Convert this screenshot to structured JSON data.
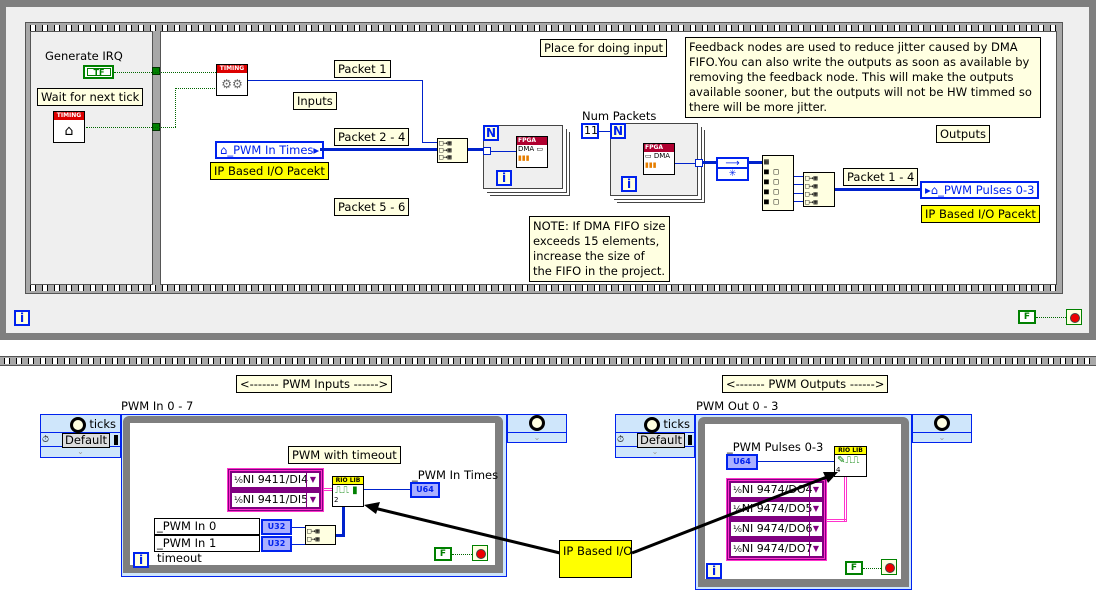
{
  "top_loop": {
    "left_frame": {
      "generate_irq_label": "Generate IRQ",
      "generate_irq_value": "TF",
      "wait_label": "Wait for next tick",
      "timing_icon_label": "TIMING"
    },
    "right_frame": {
      "timing_icon_label": "TIMING",
      "packet1_label": "Packet 1",
      "inputs_label": "Inputs",
      "packet24_label": "Packet 2 - 4",
      "packet56_label": "Packet 5 - 6",
      "pwm_in_times_global": "_PWM In Times",
      "ip_packet_label_in": "IP Based I/O Pacekt",
      "place_input_label": "Place for doing input",
      "for_loop_1": {
        "count_symbol": "N",
        "index_symbol": "i",
        "fpga_label": "FPGA",
        "dma_label": "DMA"
      },
      "num_packets_label": "Num Packets",
      "num_packets_value": "11",
      "for_loop_2": {
        "count_symbol": "N",
        "index_symbol": "i",
        "fpga_label": "FPGA",
        "dma_label": "DMA"
      },
      "feedback_note": "Feedback nodes are used to reduce jitter caused by DMA FIFO.You can also write the outputs as soon as available by removing the feedback node.  This will make the outputs available sooner, but the outputs will not be HW timmed so there will be more jitter.",
      "dma_note": "NOTE: If DMA FIFO size exceeds 15 elements, increase the size of the FIFO in the project.",
      "outputs_label": "Outputs",
      "packet14_label": "Packet 1 - 4",
      "pwm_pulses_global": "_PWM Pulses 0-3",
      "ip_packet_label_out": "IP Based I/O Pacekt"
    },
    "index_symbol": "i",
    "stop_const": "F"
  },
  "bottom": {
    "pwm_inputs_banner": "<------- PWM Inputs ------>",
    "pwm_outputs_banner": "<------- PWM Outputs ------>",
    "ip_based_io_label": "IP Based I/O",
    "inputs_loop": {
      "name": "PWM In 0 - 7",
      "ticks_label": "ticks",
      "source_value": "Default",
      "comment": "PWM with timeout",
      "io_channels": [
        "NI 9411/DI4",
        "NI 9411/DI5"
      ],
      "riolib_label": "RIO LIB",
      "riolib_count": "2",
      "output_global": "_PWM In Times",
      "output_type": "U64",
      "timeouts": [
        {
          "label": "_PWM In 0 timeout",
          "type": "U32"
        },
        {
          "label": "_PWM In 1 timeout",
          "type": "U32"
        }
      ],
      "index_symbol": "i",
      "stop_const": "F"
    },
    "outputs_loop": {
      "name": "PWM Out 0 - 3",
      "ticks_label": "ticks",
      "source_value": "Default",
      "input_global": "_PWM Pulses 0-3",
      "input_type": "U64",
      "riolib_label": "RIO LIB",
      "riolib_count": "4",
      "io_channels": [
        "NI 9474/DO4",
        "NI 9474/DO5",
        "NI 9474/DO6",
        "NI 9474/DO7"
      ],
      "index_symbol": "i",
      "stop_const": "F"
    }
  },
  "colors": {
    "wire_numeric": "#0022cc",
    "wire_boolean": "#006600",
    "io_wire": "#ff33cc",
    "loop_border": "#7f7f7f",
    "timed_loop": "#cfe6fb",
    "comment_bg": "#ffffe1",
    "highlight_bg": "#ffff00"
  }
}
